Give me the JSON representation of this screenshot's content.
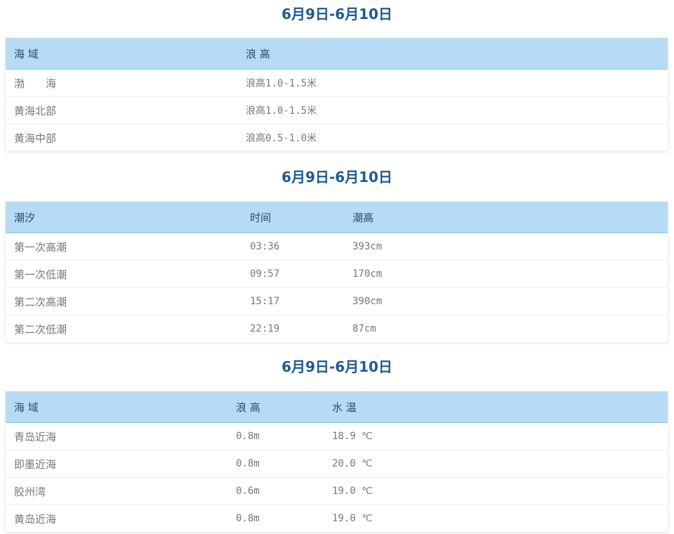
{
  "section1": {
    "title": "6月9日-6月10日",
    "headers": [
      "海 域",
      "浪 高"
    ],
    "rows": [
      [
        "渤　　海",
        "浪高1.0-1.5米"
      ],
      [
        "黄海北部",
        "浪高1.0-1.5米"
      ],
      [
        "黄海中部",
        "浪高0.5-1.0米"
      ]
    ]
  },
  "section2": {
    "title": "6月9日-6月10日",
    "headers": [
      "潮汐",
      "时间",
      "潮高"
    ],
    "rows": [
      [
        "第一次高潮",
        "03:36",
        "393cm"
      ],
      [
        "第一次低潮",
        "09:57",
        "170cm"
      ],
      [
        "第二次高潮",
        "15:17",
        "390cm"
      ],
      [
        "第二次低潮",
        "22:19",
        "87cm"
      ]
    ]
  },
  "section3": {
    "title": "6月9日-6月10日",
    "headers": [
      "海 域",
      "浪 高",
      "水 温"
    ],
    "rows": [
      [
        "青岛近海",
        "0.8m",
        "18.9 ℃"
      ],
      [
        "即墨近海",
        "0.8m",
        "20.0 ℃"
      ],
      [
        "胶州湾",
        "0.6m",
        "19.0 ℃"
      ],
      [
        "黄岛近海",
        "0.8m",
        "19.0 ℃"
      ]
    ]
  }
}
